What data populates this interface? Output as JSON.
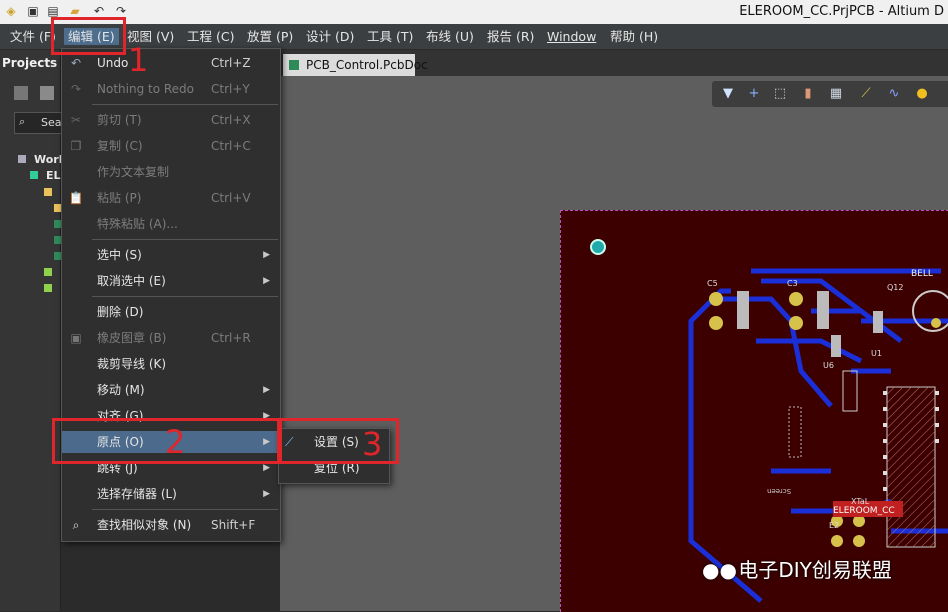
{
  "window": {
    "title": "ELEROOM_CC.PrjPCB - Altium D"
  },
  "menubar": {
    "items": [
      "文件 (F)",
      "编辑 (E)",
      "视图 (V)",
      "工程 (C)",
      "放置 (P)",
      "设计 (D)",
      "工具 (T)",
      "布线 (U)",
      "报告 (R)",
      "Window",
      "帮助 (H)"
    ]
  },
  "panel": {
    "title": "Projects",
    "search_placeholder": "Sea",
    "tree": [
      "Work",
      "EL"
    ]
  },
  "document_tab": {
    "label": "PCB_Control.PcbDoc"
  },
  "edit_menu": {
    "items": [
      {
        "label": "Undo",
        "shortcut": "Ctrl+Z"
      },
      {
        "label": "Nothing to Redo",
        "shortcut": "Ctrl+Y"
      },
      {
        "label": "剪切 (T)",
        "shortcut": "Ctrl+X"
      },
      {
        "label": "复制 (C)",
        "shortcut": "Ctrl+C"
      },
      {
        "label": "作为文本复制",
        "shortcut": ""
      },
      {
        "label": "粘贴 (P)",
        "shortcut": "Ctrl+V"
      },
      {
        "label": "特殊粘贴 (A)...",
        "shortcut": ""
      },
      {
        "label": "选中 (S)",
        "shortcut": ""
      },
      {
        "label": "取消选中 (E)",
        "shortcut": ""
      },
      {
        "label": "删除 (D)",
        "shortcut": ""
      },
      {
        "label": "橡皮图章 (B)",
        "shortcut": "Ctrl+R"
      },
      {
        "label": "裁剪导线 (K)",
        "shortcut": ""
      },
      {
        "label": "移动 (M)",
        "shortcut": ""
      },
      {
        "label": "对齐 (G)",
        "shortcut": ""
      },
      {
        "label": "原点 (O)",
        "shortcut": ""
      },
      {
        "label": "跳转 (J)",
        "shortcut": ""
      },
      {
        "label": "选择存储器 (L)",
        "shortcut": ""
      },
      {
        "label": "查找相似对象 (N)",
        "shortcut": "Shift+F"
      }
    ]
  },
  "origin_submenu": {
    "items": [
      {
        "label": "设置 (S)"
      },
      {
        "label": "复位 (R)"
      }
    ]
  },
  "annotations": {
    "step1": "1",
    "step2": "2",
    "step3": "3"
  },
  "pcb_labels": {
    "bell": "BELL",
    "u6": "U6",
    "u1": "U1",
    "c5": "C5",
    "c3": "C3",
    "q12": "Q12",
    "xtal": "XTaL",
    "e2": "E2",
    "eleroom": "ELEROOM_CC",
    "screen": "Screen"
  },
  "watermark": {
    "text": "电子DIY创易联盟"
  },
  "colors": {
    "accent_red": "#e0262a",
    "menu_highlight": "#4b6a8c",
    "board": "#3c0000",
    "trace": "#1a2fd8"
  }
}
